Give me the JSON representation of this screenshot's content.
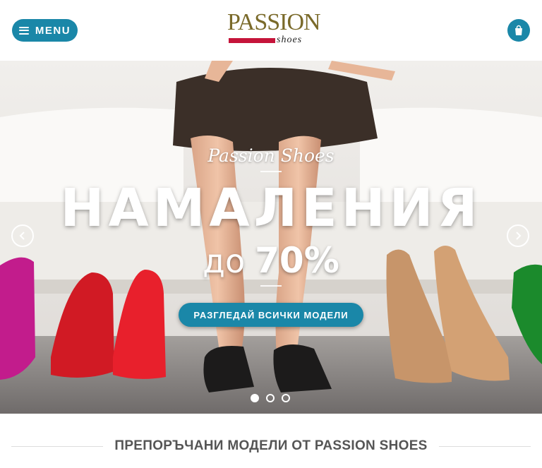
{
  "header": {
    "menu_label": "MENU",
    "logo": {
      "line1": "PASSION",
      "line2": "shoes"
    },
    "cart_icon": "shopping-bag-icon"
  },
  "hero": {
    "script_title": "Passion Shoes",
    "headline": "НАМАЛЕНИЯ",
    "discount_prefix": "до",
    "discount_value": "70%",
    "cta_label": "РАЗГЛЕДАЙ ВСИЧКИ МОДЕЛИ",
    "slides_total": 3,
    "active_slide": 1,
    "prev_icon": "chevron-left-icon",
    "next_icon": "chevron-right-icon"
  },
  "section": {
    "title": "ПРЕПОРЪЧАНИ МОДЕЛИ ОТ PASSION SHOES"
  },
  "colors": {
    "accent": "#1a87a8",
    "logo_red": "#c5143a",
    "logo_gold": "#7a6a2a"
  }
}
